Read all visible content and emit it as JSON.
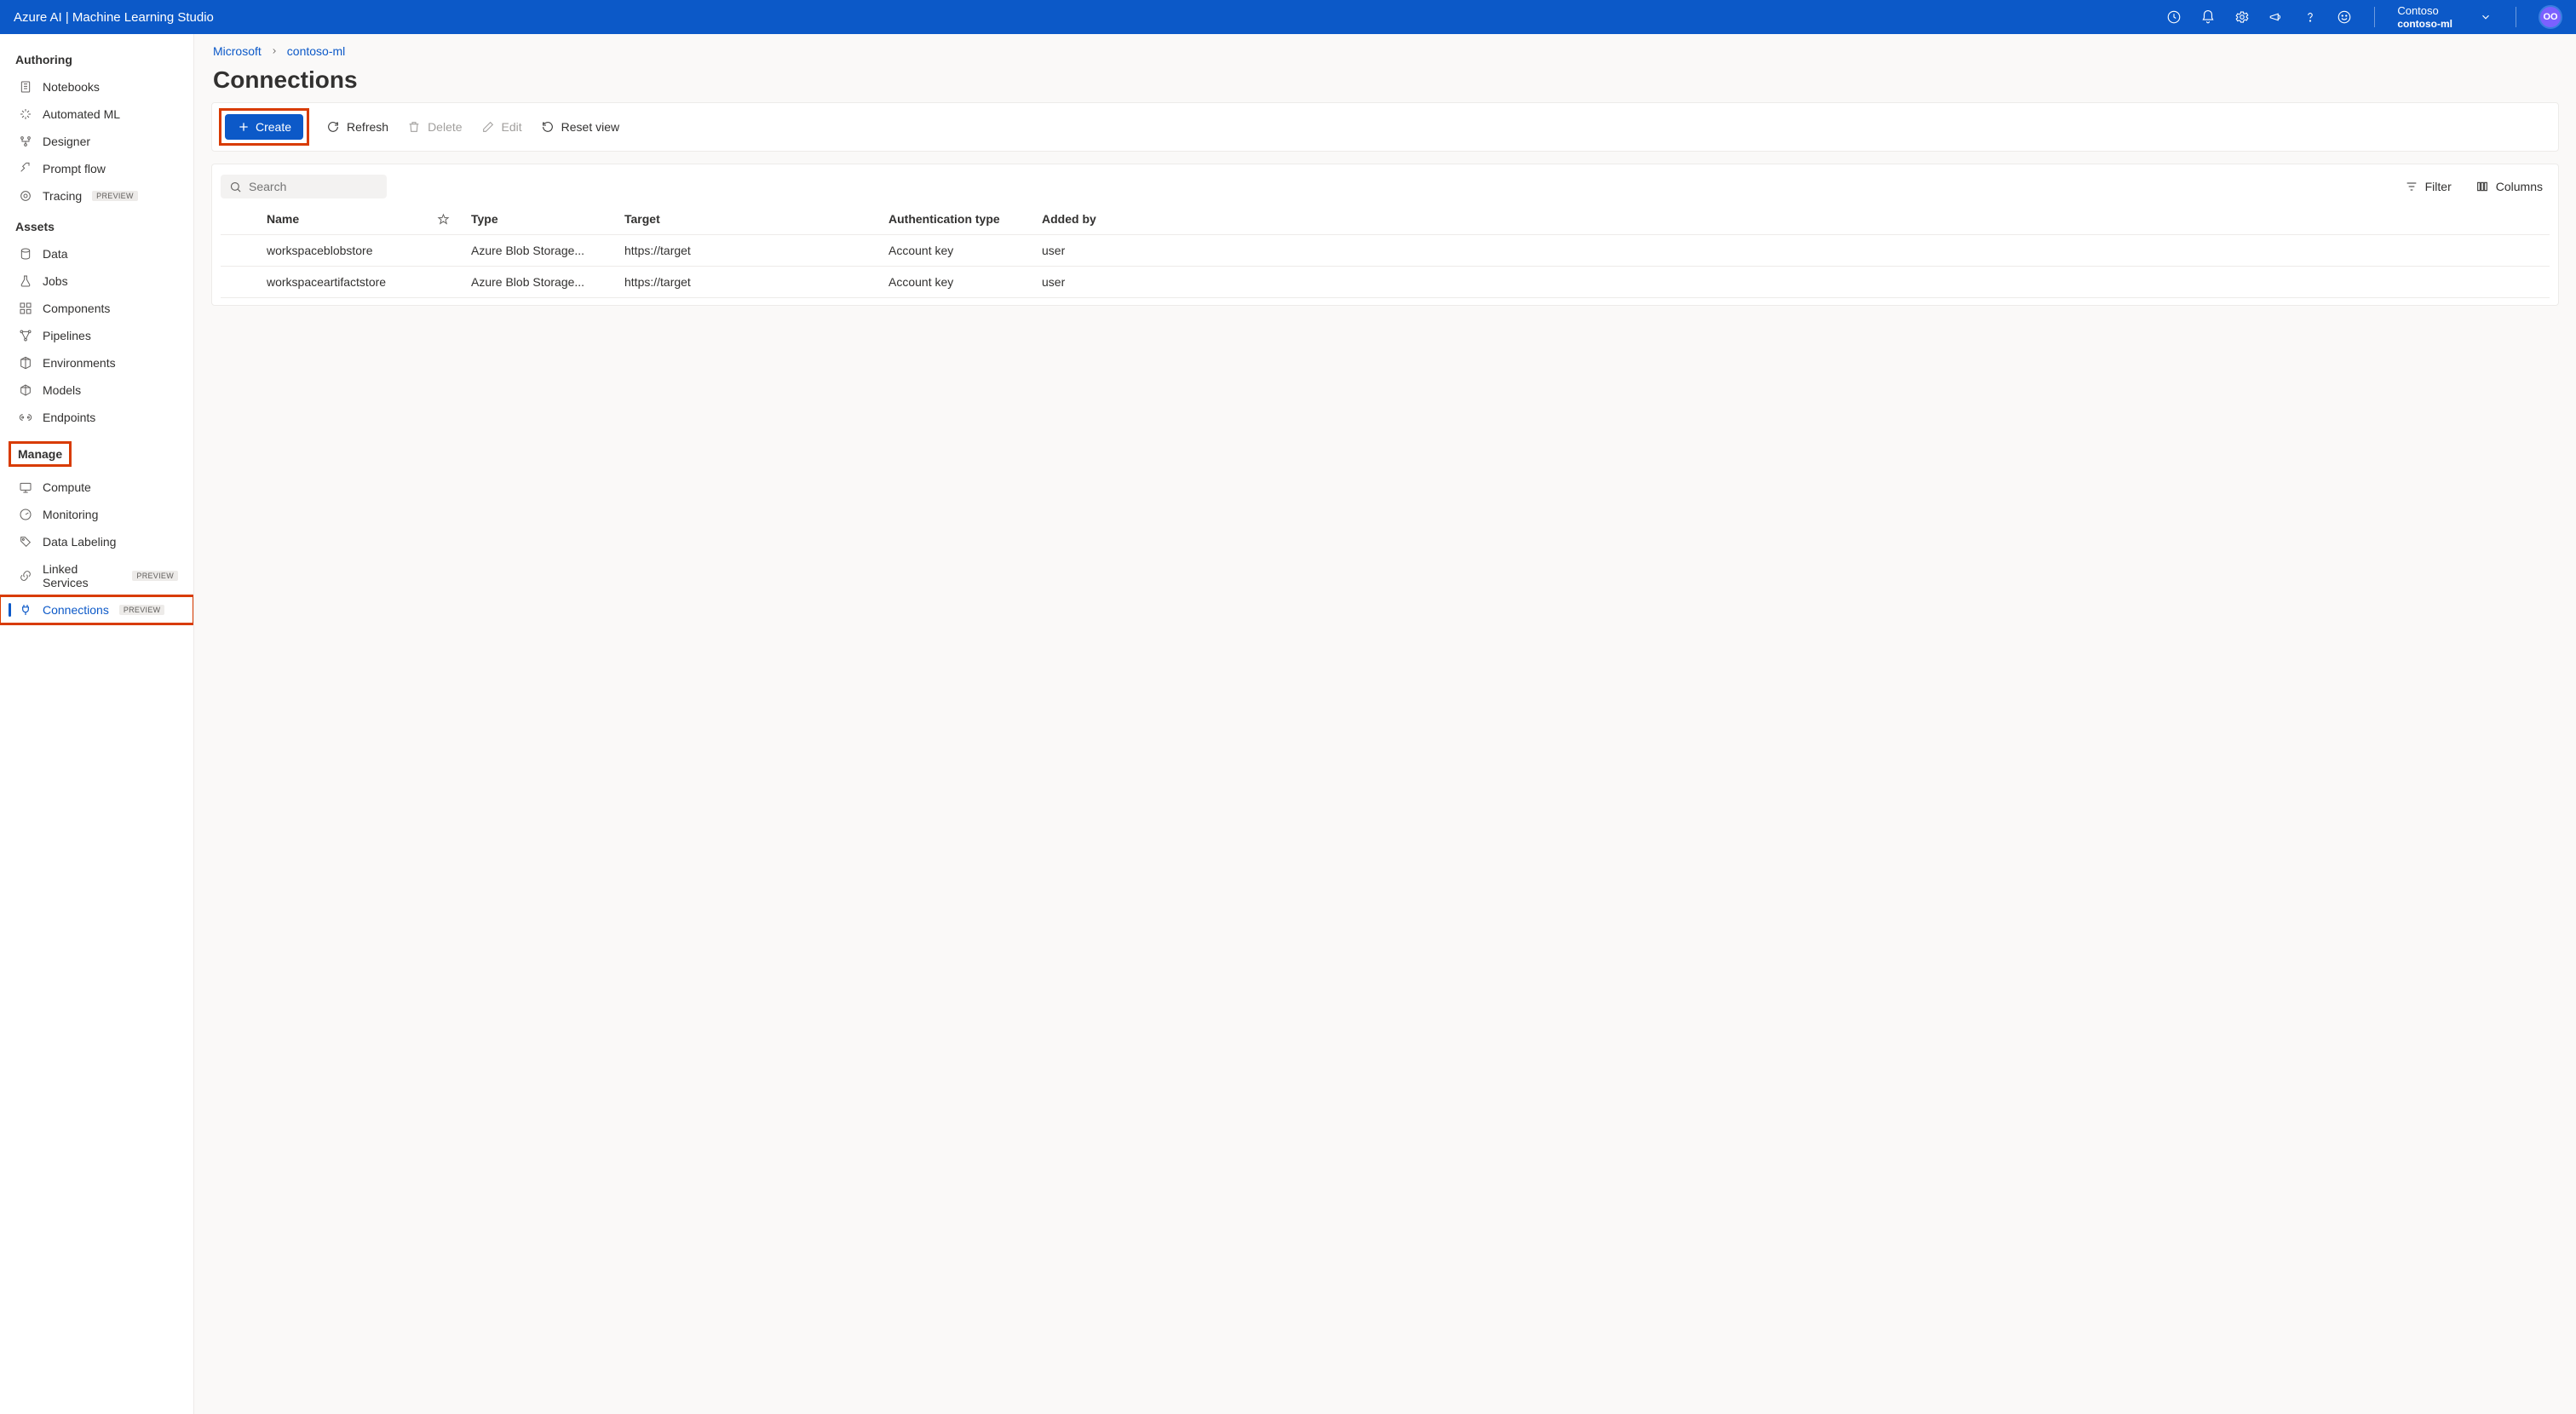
{
  "topbar": {
    "title": "Azure AI | Machine Learning Studio",
    "org_name": "Contoso",
    "org_sub": "contoso-ml",
    "avatar": "OO"
  },
  "sidebar": {
    "sections": {
      "authoring": "Authoring",
      "assets": "Assets",
      "manage": "Manage"
    },
    "items": {
      "notebooks": "Notebooks",
      "automl": "Automated ML",
      "designer": "Designer",
      "promptflow": "Prompt flow",
      "tracing": "Tracing",
      "data": "Data",
      "jobs": "Jobs",
      "components": "Components",
      "pipelines": "Pipelines",
      "environments": "Environments",
      "models": "Models",
      "endpoints": "Endpoints",
      "compute": "Compute",
      "monitoring": "Monitoring",
      "datalabeling": "Data Labeling",
      "linkedservices": "Linked Services",
      "connections": "Connections"
    },
    "preview_badge": "PREVIEW"
  },
  "breadcrumb": {
    "root": "Microsoft",
    "child": "contoso-ml"
  },
  "page": {
    "title": "Connections"
  },
  "toolbar": {
    "create": "Create",
    "refresh": "Refresh",
    "delete": "Delete",
    "edit": "Edit",
    "reset": "Reset view"
  },
  "search": {
    "placeholder": "Search"
  },
  "table_actions": {
    "filter": "Filter",
    "columns": "Columns"
  },
  "table": {
    "headers": {
      "name": "Name",
      "type": "Type",
      "target": "Target",
      "auth": "Authentication type",
      "added": "Added by"
    },
    "rows": [
      {
        "name": "workspaceblobstore",
        "type": "Azure Blob Storage...",
        "target": "https://target",
        "auth": "Account key",
        "added": "user"
      },
      {
        "name": "workspaceartifactstore",
        "type": "Azure Blob Storage...",
        "target": "https://target",
        "auth": "Account key",
        "added": "user"
      }
    ]
  }
}
